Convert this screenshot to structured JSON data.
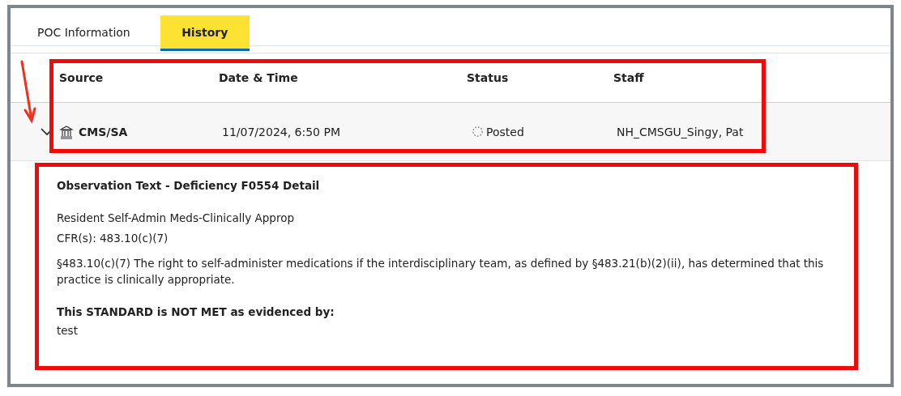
{
  "tabs": [
    {
      "label": "POC Information",
      "selected": false
    },
    {
      "label": "History",
      "selected": true
    }
  ],
  "history_table": {
    "highlighted": true,
    "columns": [
      "Source",
      "Date & Time",
      "Status",
      "Staff"
    ],
    "rows": [
      {
        "expanded": true,
        "pointer_arrow": true,
        "source": "CMS/SA",
        "date_time": "11/07/2024, 6:50 PM",
        "status": "Posted",
        "staff": "NH_CMSGU_Singy, Pat"
      }
    ]
  },
  "detail": {
    "highlighted": true,
    "title": "Observation Text - Deficiency F0554 Detail",
    "lines": [
      "Resident Self-Admin Meds-Clinically Approp",
      "CFR(s): 483.10(c)(7)"
    ],
    "paragraph": "§483.10(c)(7) The right to self-administer medications if the interdisciplinary team, as defined by §483.21(b)(2)(ii), has determined that this practice is clinically appropriate.",
    "evidence_heading": "This STANDARD is NOT MET as evidenced by:",
    "evidence": "test"
  }
}
